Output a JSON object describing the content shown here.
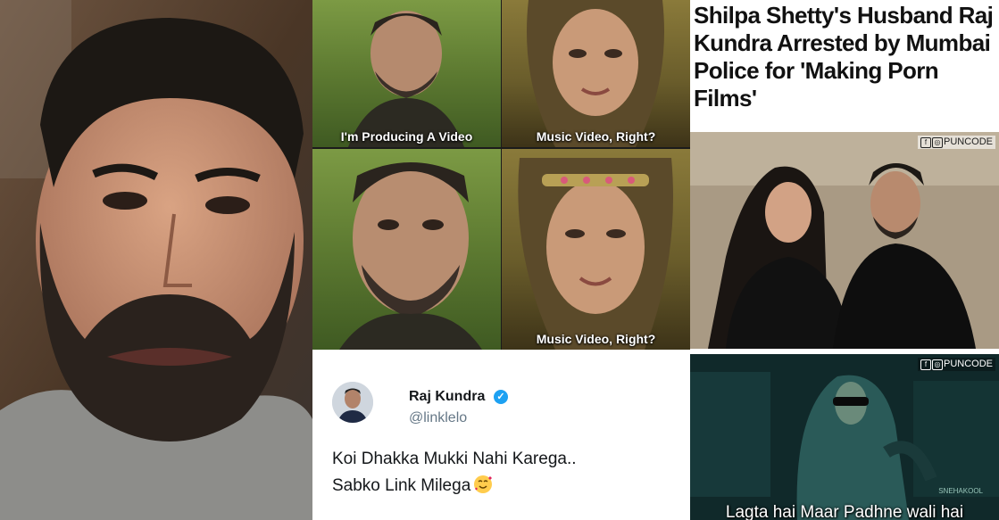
{
  "meme": {
    "captions": [
      "I'm Producing A Video",
      "Music Video, Right?",
      "",
      "Music Video, Right?"
    ]
  },
  "tweet": {
    "name": "Raj Kundra",
    "handle": "@linklelo",
    "line1": "Koi Dhakka Mukki Nahi Karega..",
    "line2": "Sabko Link Milega",
    "verified_color": "#1da1f2"
  },
  "headline": {
    "text": "Shilpa Shetty's Husband Raj Kundra Arrested by Mumbai Police for 'Making Porn Films'"
  },
  "couple": {
    "brand": "PUNCODE"
  },
  "film": {
    "brand": "PUNCODE",
    "caption": "Lagta hai Maar Padhne wali hai",
    "signature": "SNEHAKOOL"
  },
  "icons": [
    "facebook-icon",
    "instagram-icon",
    "verified-badge-icon",
    "smiling-hearts-emoji-icon"
  ]
}
